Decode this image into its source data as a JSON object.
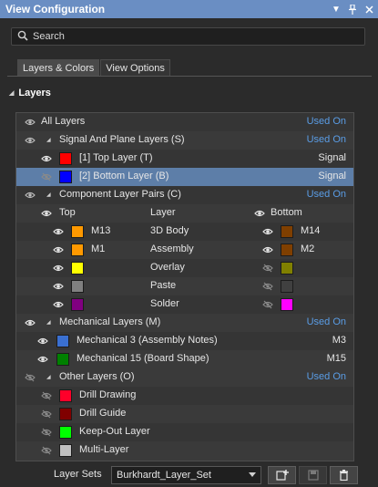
{
  "window": {
    "title": "View Configuration"
  },
  "search": {
    "placeholder": "Search"
  },
  "tabs": [
    {
      "label": "Layers & Colors"
    },
    {
      "label": "View Options"
    }
  ],
  "section": {
    "label": "Layers"
  },
  "layers": {
    "all": {
      "label": "All Layers",
      "link": "Used On"
    },
    "signal_group": {
      "label": "Signal And Plane Layers (S)",
      "link": "Used On"
    },
    "top_layer": {
      "label": "[1] Top Layer (T)",
      "type": "Signal",
      "color": "#ff0000"
    },
    "bottom_layer": {
      "label": "[2] Bottom Layer (B)",
      "type": "Signal",
      "color": "#0000ff"
    },
    "component_group": {
      "label": "Component Layer Pairs (C)",
      "link": "Used On"
    },
    "pair_header": {
      "top": "Top",
      "layer": "Layer",
      "bottom": "Bottom"
    },
    "pairs": [
      {
        "top_name": "M13",
        "top_color": "#ff9900",
        "name": "3D Body",
        "bottom_name": "M14",
        "bottom_color": "#7f3f00"
      },
      {
        "top_name": "M1",
        "top_color": "#ff9900",
        "name": "Assembly",
        "bottom_name": "M2",
        "bottom_color": "#7f3f00"
      },
      {
        "top_name": "",
        "top_color": "#ffff00",
        "name": "Overlay",
        "bottom_name": "",
        "bottom_color": "#808000"
      },
      {
        "top_name": "",
        "top_color": "#808080",
        "name": "Paste",
        "bottom_name": "",
        "bottom_color": "#404040"
      },
      {
        "top_name": "",
        "top_color": "#800080",
        "name": "Solder",
        "bottom_name": "",
        "bottom_color": "#ff00ff"
      }
    ],
    "mechanical_group": {
      "label": "Mechanical Layers (M)",
      "link": "Used On"
    },
    "mechanical": [
      {
        "label": "Mechanical 3 (Assembly Notes)",
        "code": "M3",
        "color": "#3a6fd0"
      },
      {
        "label": "Mechanical 15 (Board Shape)",
        "code": "M15",
        "color": "#008000"
      }
    ],
    "other_group": {
      "label": "Other Layers (O)",
      "link": "Used On"
    },
    "other": [
      {
        "label": "Drill Drawing",
        "color": "#ff002a"
      },
      {
        "label": "Drill Guide",
        "color": "#800000"
      },
      {
        "label": "Keep-Out Layer",
        "color": "#00ff00"
      },
      {
        "label": "Multi-Layer",
        "color": "#c0c0c0"
      }
    ]
  },
  "footer": {
    "label": "Layer Sets",
    "layer_set": "Burkhardt_Layer_Set"
  }
}
